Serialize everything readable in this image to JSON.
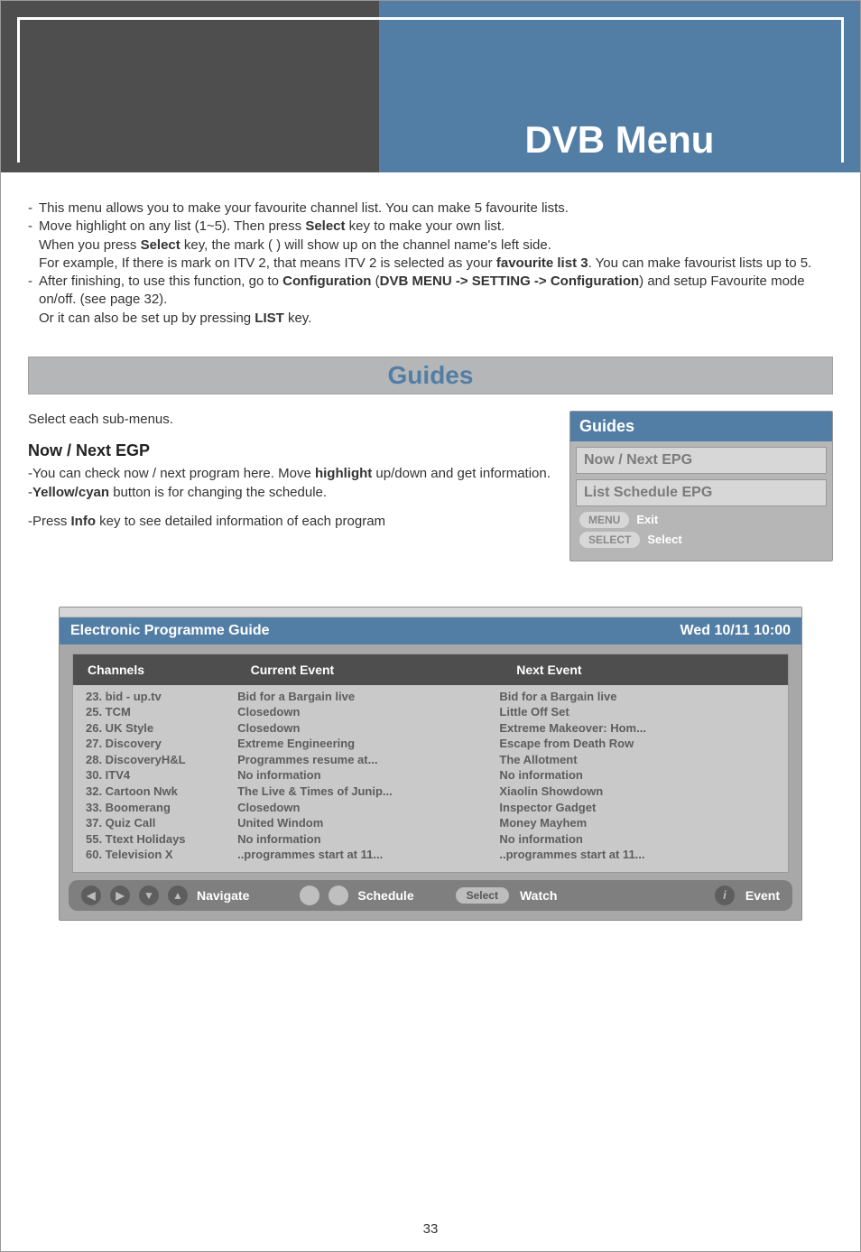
{
  "page": {
    "title": "DVB Menu",
    "number": "33"
  },
  "intro": {
    "line1": "This menu allows you to make your favourite channel list. You can make 5 favourite lists.",
    "line2a": "Move highlight on any list (1~5). Then press ",
    "line2b": "Select",
    "line2c": " key to make your own list.",
    "line3a": "When you press ",
    "line3b": "Select",
    "line3c": " key, the mark (               ) will show up on the channel name's left side.",
    "line4a": "For example, If there is     mark on ITV 2,  that means ITV 2 is selected as your ",
    "line4b": "favourite list 3",
    "line4c": ". You can make favourist lists up to 5.",
    "line5a": "After finishing, to use this function, go to ",
    "line5b": "Configuration",
    "line5c": " (",
    "line5d": "DVB MENU -> SETTING -> Configuration",
    "line5e": ") and setup Favourite mode on/off. (see page 32).",
    "line6a": "Or it can also be set up by pressing ",
    "line6b": "LIST",
    "line6c": " key."
  },
  "guides": {
    "bar_title": "Guides",
    "select_each": "Select each sub-menus.",
    "heading": "Now / Next EGP",
    "bullet1a": "You can check now / next program here. Move ",
    "bullet1b": "highlight",
    "bullet1c": " up/down and get information.",
    "bullet2a": "Yellow/cyan",
    "bullet2b": " button is for changing the schedule.",
    "bullet3a": "Press ",
    "bullet3b": "Info",
    "bullet3c": " key to see detailed information of each program",
    "panel": {
      "title": "Guides",
      "item1": "Now / Next EPG",
      "item2": "List Schedule EPG",
      "menu_pill": "MENU",
      "menu_label": "Exit",
      "select_pill": "SELECT",
      "select_label": "Select"
    }
  },
  "epg": {
    "title": "Electronic Programme Guide",
    "datetime": "Wed 10/11 10:00",
    "columns": {
      "a": "Channels",
      "b": "Current Event",
      "c": "Next Event"
    },
    "rows": [
      {
        "ch": "23. bid - up.tv",
        "cur": "Bid for a Bargain live",
        "next": "Bid for a Bargain live"
      },
      {
        "ch": "25. TCM",
        "cur": "Closedown",
        "next": "Little Off Set"
      },
      {
        "ch": "26. UK Style",
        "cur": "Closedown",
        "next": "Extreme Makeover: Hom..."
      },
      {
        "ch": "27. Discovery",
        "cur": "Extreme Engineering",
        "next": "Escape from Death Row"
      },
      {
        "ch": "28. DiscoveryH&L",
        "cur": "Programmes resume at...",
        "next": "The Allotment"
      },
      {
        "ch": "30. ITV4",
        "cur": "No information",
        "next": "No information"
      },
      {
        "ch": "32. Cartoon Nwk",
        "cur": "The Live & Times of Junip...",
        "next": "Xiaolin Showdown"
      },
      {
        "ch": "33. Boomerang",
        "cur": "Closedown",
        "next": "Inspector Gadget"
      },
      {
        "ch": "37. Quiz Call",
        "cur": "United Windom",
        "next": "Money Mayhem"
      },
      {
        "ch": "55. Ttext Holidays",
        "cur": "No information",
        "next": "No information"
      },
      {
        "ch": "60. Television X",
        "cur": "..programmes start at 11...",
        "next": "..programmes start at 11..."
      }
    ],
    "footer": {
      "navigate": "Navigate",
      "schedule": "Schedule",
      "select": "Select",
      "watch": "Watch",
      "i": "i",
      "event": "Event"
    }
  }
}
